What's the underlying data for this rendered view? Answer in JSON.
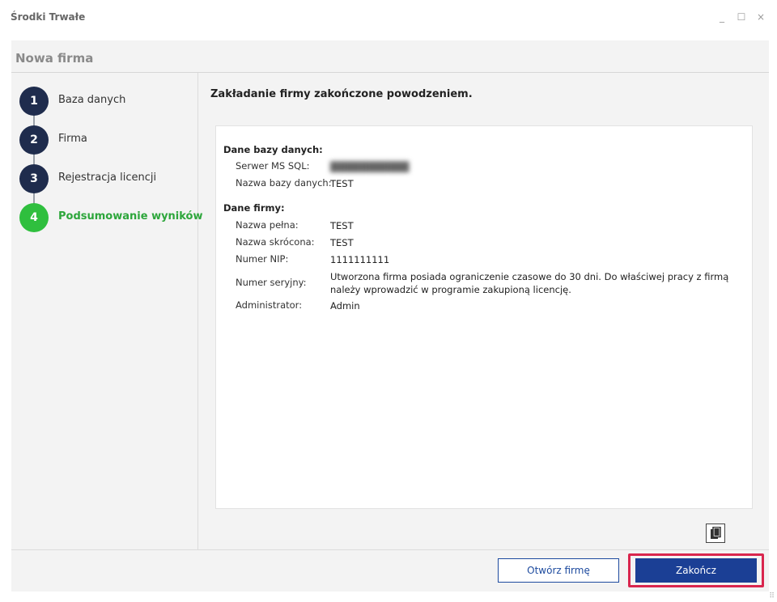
{
  "window": {
    "title": "Środki Trwałe",
    "minimize_glyph": "_",
    "maximize_glyph": "☐",
    "close_glyph": "×"
  },
  "dialog": {
    "header_title": "Nowa firma"
  },
  "steps": [
    {
      "number": "1",
      "label": "Baza danych",
      "state": "done"
    },
    {
      "number": "2",
      "label": "Firma",
      "state": "done"
    },
    {
      "number": "3",
      "label": "Rejestracja licencji",
      "state": "done"
    },
    {
      "number": "4",
      "label": "Podsumowanie wyników",
      "state": "active"
    }
  ],
  "content": {
    "title": "Zakładanie firmy zakończone powodzeniem."
  },
  "summary": {
    "database_section": {
      "title": "Dane bazy danych:",
      "server_label": "Serwer MS SQL:",
      "server_value": "",
      "db_name_label": "Nazwa bazy danych:",
      "db_name_value": "TEST"
    },
    "company_section": {
      "title": "Dane firmy:",
      "full_name_label": "Nazwa pełna:",
      "full_name_value": "TEST",
      "short_name_label": "Nazwa skrócona:",
      "short_name_value": "TEST",
      "nip_label": "Numer NIP:",
      "nip_value": "1111111111",
      "serial_label": "Numer seryjny:",
      "serial_value": "Utworzona firma posiada ograniczenie czasowe do 30 dni. Do właściwej pracy z firmą należy wprowadzić w programie zakupioną licencję.",
      "admin_label": "Administrator:",
      "admin_value": "Admin"
    }
  },
  "footer": {
    "open_button": "Otwórz firmę",
    "finish_button": "Zakończ"
  },
  "colors": {
    "step_inactive": "#1f2c4d",
    "step_active": "#2fbf3e",
    "primary_button": "#1b3f95",
    "highlight_border": "#d9264e"
  },
  "icons": {
    "copy": "copy-icon",
    "resize": "resize-grip-icon"
  }
}
